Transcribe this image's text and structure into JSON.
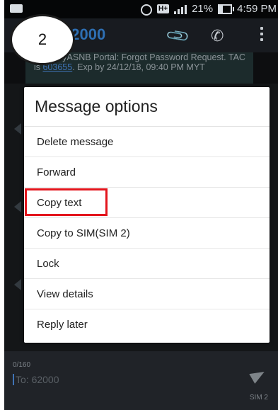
{
  "status_bar": {
    "battery": "21%",
    "time": "4:59 PM",
    "network_type": "H+"
  },
  "header": {
    "contact_number": "62000",
    "attach_icon": "paperclip-icon",
    "call_icon": "phone-icon",
    "menu_icon": "overflow-menu-icon"
  },
  "message": {
    "text_before_code": "RM0 MyASNB Portal: Forgot Password Request. TAC is ",
    "tac_code": "603655",
    "text_after_code": ". Exp by 24/12/18, 09:40 PM MYT"
  },
  "step_badge": "2",
  "dialog": {
    "title": "Message options",
    "options": [
      "Delete message",
      "Forward",
      "Copy text",
      "Copy to SIM(SIM 2)",
      "Lock",
      "View details",
      "Reply later"
    ],
    "highlighted_option": "Copy text",
    "highlight_color": "#e3141c"
  },
  "compose": {
    "char_counter": "0/160",
    "placeholder": "To: 62000",
    "sim_label": "SIM 2"
  }
}
